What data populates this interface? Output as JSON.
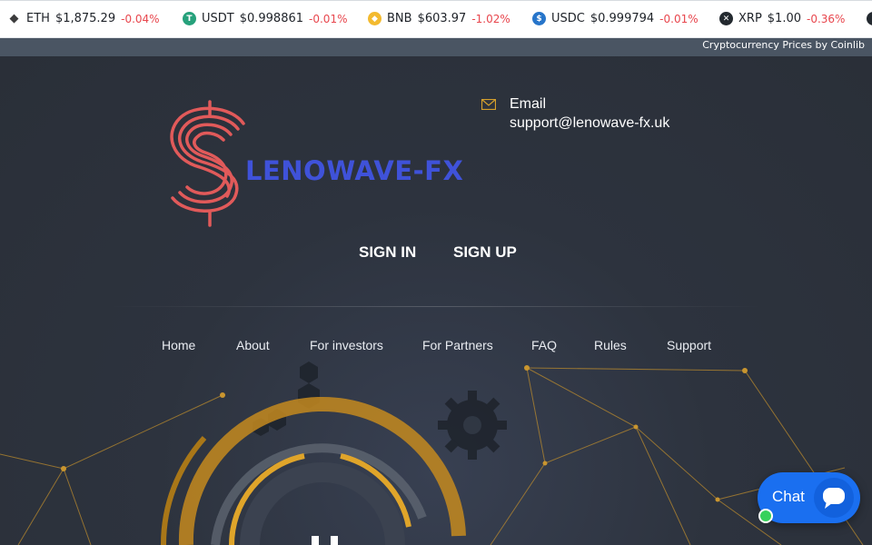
{
  "ticker": {
    "items": [
      {
        "symbol": "ETH",
        "price": "$1,875.29",
        "change": "-0.04%",
        "icon": "eth-icon",
        "color": "#3c3c3d"
      },
      {
        "symbol": "USDT",
        "price": "$0.998861",
        "change": "-0.01%",
        "icon": "usdt-icon",
        "color": "#26a17b"
      },
      {
        "symbol": "BNB",
        "price": "$603.97",
        "change": "-1.02%",
        "icon": "bnb-icon",
        "color": "#f3ba2f"
      },
      {
        "symbol": "USDC",
        "price": "$0.999794",
        "change": "-0.01%",
        "icon": "usdc-icon",
        "color": "#2775ca"
      },
      {
        "symbol": "XRP",
        "price": "$1.00",
        "change": "-0.36%",
        "icon": "xrp-icon",
        "color": "#23292f"
      }
    ],
    "credit": "Cryptocurrency Prices by Coinlib"
  },
  "brand": {
    "name": "LENOWAVE-FX",
    "logo_color": "#e15a5a",
    "text_color": "#3f52d9"
  },
  "contact": {
    "label": "Email",
    "value": "support@lenowave-fx.uk"
  },
  "auth": {
    "sign_in": "SIGN IN",
    "sign_up": "SIGN UP"
  },
  "nav": [
    "Home",
    "About",
    "For investors",
    "For Partners",
    "FAQ",
    "Rules",
    "Support"
  ],
  "chat": {
    "label": "Chat",
    "color": "#1a6ff0"
  }
}
